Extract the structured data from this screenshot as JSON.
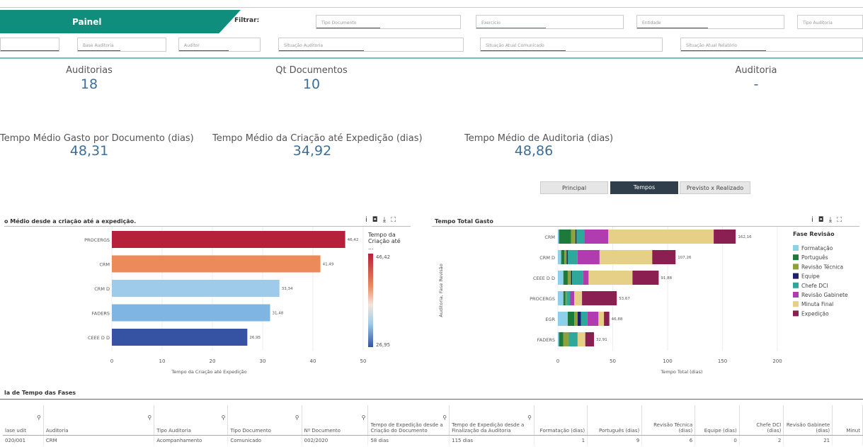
{
  "header": {
    "tab_label": "Painel",
    "filter_label": "Filtrar:"
  },
  "filters": {
    "row1": [
      "Tipo Documento",
      "Exercício",
      "Entidade",
      "Tipo Auditoria"
    ],
    "row2": [
      "",
      "Base Auditoria",
      "Auditor",
      "Situação Auditoria",
      "Situação Atual Comunicado",
      "Situação Atual Relatório"
    ]
  },
  "kpis": {
    "auditorias": {
      "label": "Auditorias",
      "value": "18"
    },
    "qt_documentos": {
      "label": "Qt Documentos",
      "value": "10"
    },
    "auditoria": {
      "label": "Auditoria",
      "value": "-"
    },
    "tempo_doc": {
      "label": "Tempo Médio Gasto por Documento (dias)",
      "value": "48,31"
    },
    "tempo_criacao": {
      "label": "Tempo Médio da Criação até Expedição (dias)",
      "value": "34,92"
    },
    "tempo_auditoria": {
      "label": "Tempo Médio de Auditoria (dias)",
      "value": "48,86"
    }
  },
  "view_tabs": {
    "principal": "Principal",
    "tempos": "Tempos",
    "previsto": "Previsto x Realizado",
    "active": "Tempos"
  },
  "icons": {
    "tools": [
      "info-icon",
      "camera-icon",
      "download-icon",
      "fullscreen-icon"
    ]
  },
  "colors": {
    "accent": "#0f8e7e",
    "kpi_value": "#3d6e98",
    "active_tab": "#2f3e4a"
  },
  "chart_data": [
    {
      "type": "bar",
      "orientation": "horizontal",
      "title": "o Médio desde a criação até a expedição.",
      "categories": [
        "PROCERGS",
        "CRM",
        "CRM D",
        "FADERS",
        "CEEE D D"
      ],
      "values": [
        46.42,
        41.49,
        33.34,
        31.48,
        26.95
      ],
      "value_labels": [
        "46,42",
        "41,49",
        "33,34",
        "31,48",
        "26,95"
      ],
      "xlabel": "Tempo da Criação até Expedição",
      "xlim": [
        0,
        50
      ],
      "xticks": [
        "0",
        "10",
        "20",
        "30",
        "40",
        "50"
      ],
      "legend": {
        "title": "Tempo da Criação até ...",
        "max_label": "46,42",
        "min_label": "26,95",
        "placement": "right"
      },
      "colors": [
        "#b5213a",
        "#ec8a5b",
        "#9ecbe9",
        "#7fb5e2",
        "#3652a3"
      ]
    },
    {
      "type": "bar",
      "orientation": "horizontal",
      "stacked": true,
      "title": "Tempo Total Gasto",
      "categories": [
        "CRM",
        "CRM D",
        "CEEE D D",
        "PROCERGS",
        "EGR",
        "FADERS"
      ],
      "ylabel": "Auditoria, Fase Revisão",
      "xlabel": "Tempo Total (dias)",
      "xlim": [
        0,
        200
      ],
      "xticks": [
        "0",
        "50",
        "100",
        "150",
        "200"
      ],
      "totals": [
        162.16,
        107.26,
        91.88,
        53.67,
        46.88,
        32.91
      ],
      "total_labels": [
        "162,16",
        "107,26",
        "91,88",
        "53,67",
        "46,88",
        "32,91"
      ],
      "legend": {
        "title": "Fase Revisão",
        "placement": "right"
      },
      "series": [
        {
          "name": "Formatação",
          "color": "#8ecfe9",
          "values": [
            1,
            3,
            5,
            5,
            9,
            1
          ]
        },
        {
          "name": "Português",
          "color": "#1e7a3a",
          "values": [
            11,
            3,
            4,
            2,
            6,
            4
          ]
        },
        {
          "name": "Revisão Técnica",
          "color": "#8ea13a",
          "values": [
            4,
            2,
            3,
            1,
            3,
            5
          ]
        },
        {
          "name": "Equipe",
          "color": "#1f1f6e",
          "values": [
            1,
            1,
            1,
            0,
            3,
            0
          ]
        },
        {
          "name": "Chefe DCI",
          "color": "#2fa89c",
          "values": [
            7,
            9,
            10,
            3,
            6,
            8
          ]
        },
        {
          "name": "Revisão Gabinete",
          "color": "#b03cb0",
          "values": [
            22,
            20,
            5,
            4,
            10,
            0
          ]
        },
        {
          "name": "Minuta Final",
          "color": "#e6cf86",
          "values": [
            96,
            48,
            40,
            7,
            5,
            7
          ]
        },
        {
          "name": "Expedição",
          "color": "#8c1f52",
          "values": [
            20,
            21.26,
            23.88,
            31.67,
            4.88,
            7.91
          ]
        }
      ]
    }
  ],
  "table": {
    "title": "la de Tempo das Fases",
    "columns": [
      "lase udit",
      "Auditoria",
      "Tipo Auditoria",
      "Tipo Documento",
      "Nº Documento",
      "Tempo de Expedição desde a Criação do Documento",
      "Tempo de Expedição desde a Finalização da Auditoria",
      "Formatação (dias)",
      "Português (dias)",
      "Revisão Técnica (dias)",
      "Equipe (dias)",
      "Chefe DCI (dias)",
      "Revisão Gabinete (dias)",
      "Minut"
    ],
    "rows": [
      [
        "020/001",
        "CRM",
        "Acompanhamento",
        "Comunicado",
        "002/2020",
        "58 dias",
        "115 dias",
        "1",
        "9",
        "6",
        "0",
        "2",
        "21",
        ""
      ]
    ]
  }
}
